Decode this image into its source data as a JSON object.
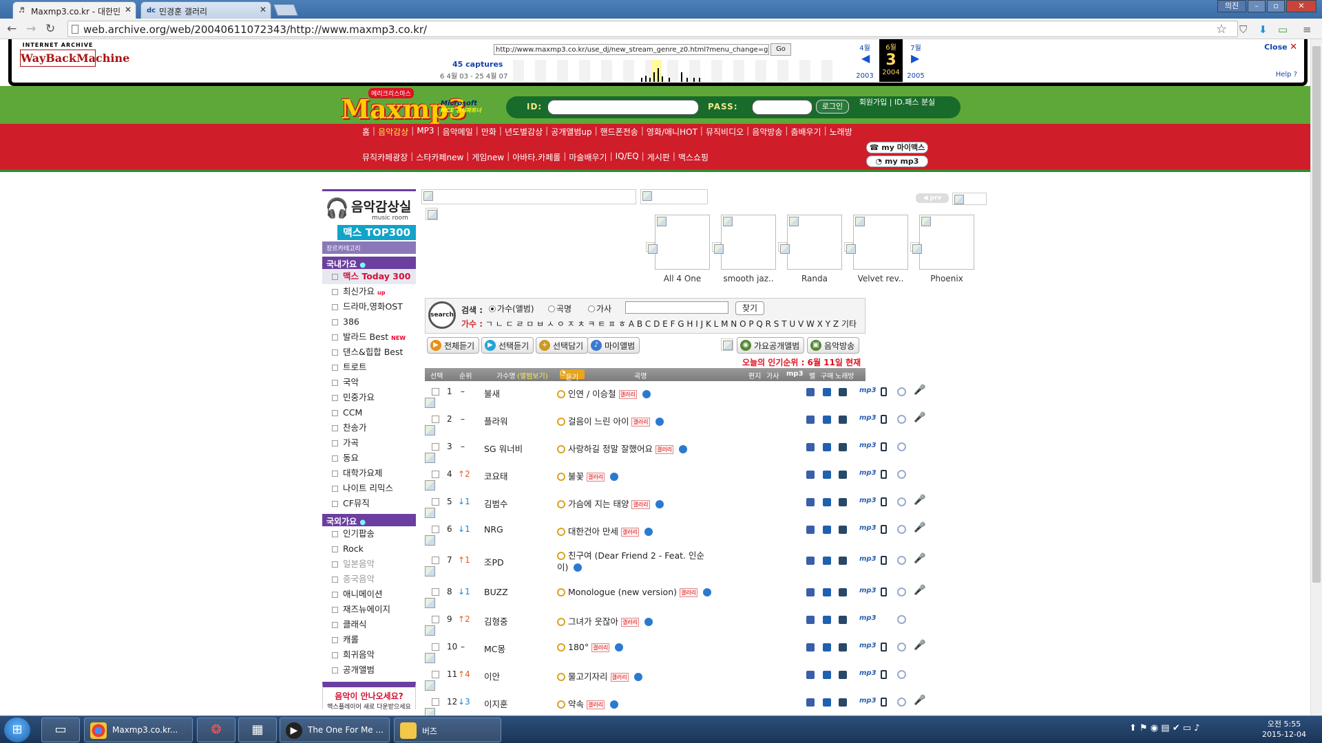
{
  "browser": {
    "tabs": [
      {
        "label": "Maxmp3.co.kr - 대한민",
        "favicon": "♬",
        "active": true
      },
      {
        "label": "민경훈 갤러리",
        "favicon": "dc",
        "active": false
      }
    ],
    "window_user": "의진",
    "url": "web.archive.org/web/20040611072343/http://www.maxmp3.co.kr/"
  },
  "wayback": {
    "logo_top": "INTERNET ARCHIVE",
    "logo_main": "WayBackMachine",
    "url_field": "http://www.maxmp3.co.kr/use_dj/new_stream_genre_z0.html?menu_change=gay",
    "go_label": "Go",
    "captures": "45 captures",
    "range": "6 4월 03 - 25 4월 07",
    "prev_month": "4월",
    "cur_month": "6월",
    "cur_day": "3",
    "next_month": "7월",
    "prev_year": "2003",
    "cur_year": "2004",
    "next_year": "2005",
    "close_label": "Close",
    "help_label": "Help ?"
  },
  "site": {
    "logo": "Maxmp3",
    "logo_badge": "메리크리스마스",
    "ms_badge_1": "Microsoft",
    "ms_badge_2": "MCE 공식파트너",
    "id_label": "ID:",
    "pass_label": "PASS:",
    "login_label": "로그인",
    "join_links": "회원가입 | ID.패스 분실",
    "menu1": [
      "홈",
      "음악감상",
      "MP3",
      "음악메일",
      "만화",
      "년도별감상",
      "공개앨범up",
      "핸드폰전송",
      "영화/애니HOT",
      "뮤직비디오",
      "음악방송",
      "춤배우기",
      "노래방"
    ],
    "menu2": [
      "뮤직카페광장",
      "스타카페new",
      "게임new",
      "아바타.카페롤",
      "마술배우기",
      "IQ/EQ",
      "게시판",
      "맥스쇼핑"
    ],
    "my_max": "my 마이맥스",
    "my_mp3": "my mp3"
  },
  "sidebar": {
    "title": "음악감상실",
    "subtitle": "music room",
    "top300": "맥스 TOP300",
    "genre_label": "장르카테고리",
    "domestic_head": "국내가요",
    "domestic": [
      {
        "label": "맥스 Today 300",
        "style": "red"
      },
      {
        "label": "최신가요",
        "tag": "up"
      },
      {
        "label": "드라마,영화OST"
      },
      {
        "label": "386"
      },
      {
        "label": "발라드 Best",
        "tag": "NEW"
      },
      {
        "label": "댄스&힙합 Best"
      },
      {
        "label": "트로트"
      },
      {
        "label": "국악"
      },
      {
        "label": "민중가요"
      },
      {
        "label": "CCM"
      },
      {
        "label": "찬송가"
      },
      {
        "label": "가곡"
      },
      {
        "label": "동요"
      },
      {
        "label": "대학가요제"
      },
      {
        "label": "나이트 리믹스"
      },
      {
        "label": "CF뮤직"
      }
    ],
    "foreign_head": "국외가요",
    "foreign": [
      {
        "label": "인기팝송"
      },
      {
        "label": "Rock"
      },
      {
        "label": "일본음악",
        "style": "grey"
      },
      {
        "label": "중국음악",
        "style": "grey"
      },
      {
        "label": "애니메이션"
      },
      {
        "label": "재즈뉴에이지"
      },
      {
        "label": "클래식"
      },
      {
        "label": "캐롤"
      },
      {
        "label": "희귀음악"
      },
      {
        "label": "공개앨범"
      }
    ],
    "ask_q": "음악이 안나오세요?",
    "ask_s": "맥스플레이어 새로 다운받으세요"
  },
  "albums": [
    {
      "caption": "All 4 One"
    },
    {
      "caption": "smooth jaz.."
    },
    {
      "caption": "Randa"
    },
    {
      "caption": "Velvet rev.."
    },
    {
      "caption": "Phoenix"
    }
  ],
  "prv_label": "prv",
  "search": {
    "circle_label": "search",
    "label": "검색 :",
    "options": [
      "가수(앨범)",
      "곡명",
      "가사"
    ],
    "button": "찾기",
    "index_label": "가수 :",
    "index_chars": "ㄱ ㄴ ㄷ ㄹ ㅁ ㅂ ㅅ ㅇ ㅈ ㅊ ㅋ ㅌ ㅍ ㅎ A B C D E F G H I J K L M N O P Q R S T U V W X Y Z 기타"
  },
  "actions": [
    "전체듣기",
    "선택듣기",
    "선택담기",
    "마이앨범",
    "가요공개앨범",
    "음악방송"
  ],
  "today_rank": "오늘의 인기순위 : 6월 11일 현재",
  "list_head": {
    "sel": "선택",
    "rank": "순위",
    "artist": "가수명",
    "artist_view": "(앨범보기)",
    "listen": "듣기",
    "song": "곡명",
    "edit": "편지",
    "lyrics": "가사",
    "mp3": "mp3",
    "bell": "벨",
    "buy": "구매",
    "karaoke": "노래방"
  },
  "rows": [
    {
      "num": "1",
      "chg": "–",
      "dir": "none",
      "artist": "불새",
      "song": "인연 / 이승철",
      "mic": true
    },
    {
      "num": "2",
      "chg": "–",
      "dir": "none",
      "artist": "플라워",
      "song": "걸음이 느린 아이",
      "mic": true
    },
    {
      "num": "3",
      "chg": "–",
      "dir": "none",
      "artist": "SG 워너비",
      "song": "사랑하길 정말 잘했어요",
      "mic": false
    },
    {
      "num": "4",
      "chg": "2",
      "dir": "up",
      "artist": "코요태",
      "song": "불꽃",
      "mic": false
    },
    {
      "num": "5",
      "chg": "1",
      "dir": "down",
      "artist": "김범수",
      "song": "가슴에 지는 태양",
      "mic": true
    },
    {
      "num": "6",
      "chg": "1",
      "dir": "down",
      "artist": "NRG",
      "song": "대한건아 만세",
      "mic": true
    },
    {
      "num": "7",
      "chg": "1",
      "dir": "up",
      "artist": "조PD",
      "song": "친구여 (Dear Friend 2 - Feat. 인순이)",
      "mic": true,
      "wrap": true
    },
    {
      "num": "8",
      "chg": "1",
      "dir": "down",
      "artist": "BUZZ",
      "song": "Monologue (new version)",
      "mic": true
    },
    {
      "num": "9",
      "chg": "2",
      "dir": "up",
      "artist": "김형중",
      "song": "그녀가 웃잖아",
      "mic": false
    },
    {
      "num": "10",
      "chg": "–",
      "dir": "none",
      "artist": "MC몽",
      "song": "180°",
      "mic": true
    },
    {
      "num": "11",
      "chg": "4",
      "dir": "up",
      "artist": "이안",
      "song": "물고기자리",
      "mic": false
    },
    {
      "num": "12",
      "chg": "3",
      "dir": "down",
      "artist": "이지훈",
      "song": "약속",
      "mic": true
    }
  ],
  "gal_tag": "갤러리",
  "taskbar": {
    "apps": [
      {
        "label": "Maxmp3.co.kr..."
      },
      {
        "label": "The One For Me ..."
      },
      {
        "label": "버즈"
      }
    ],
    "time": "오전 5:55",
    "date": "2015-12-04"
  },
  "colors": {
    "site_green": "#5ea83a",
    "site_red": "#cf1d2a",
    "sidebar_purple": "#6b3fa0",
    "rank_up": "#e85a1a",
    "rank_down": "#1a82d0"
  }
}
